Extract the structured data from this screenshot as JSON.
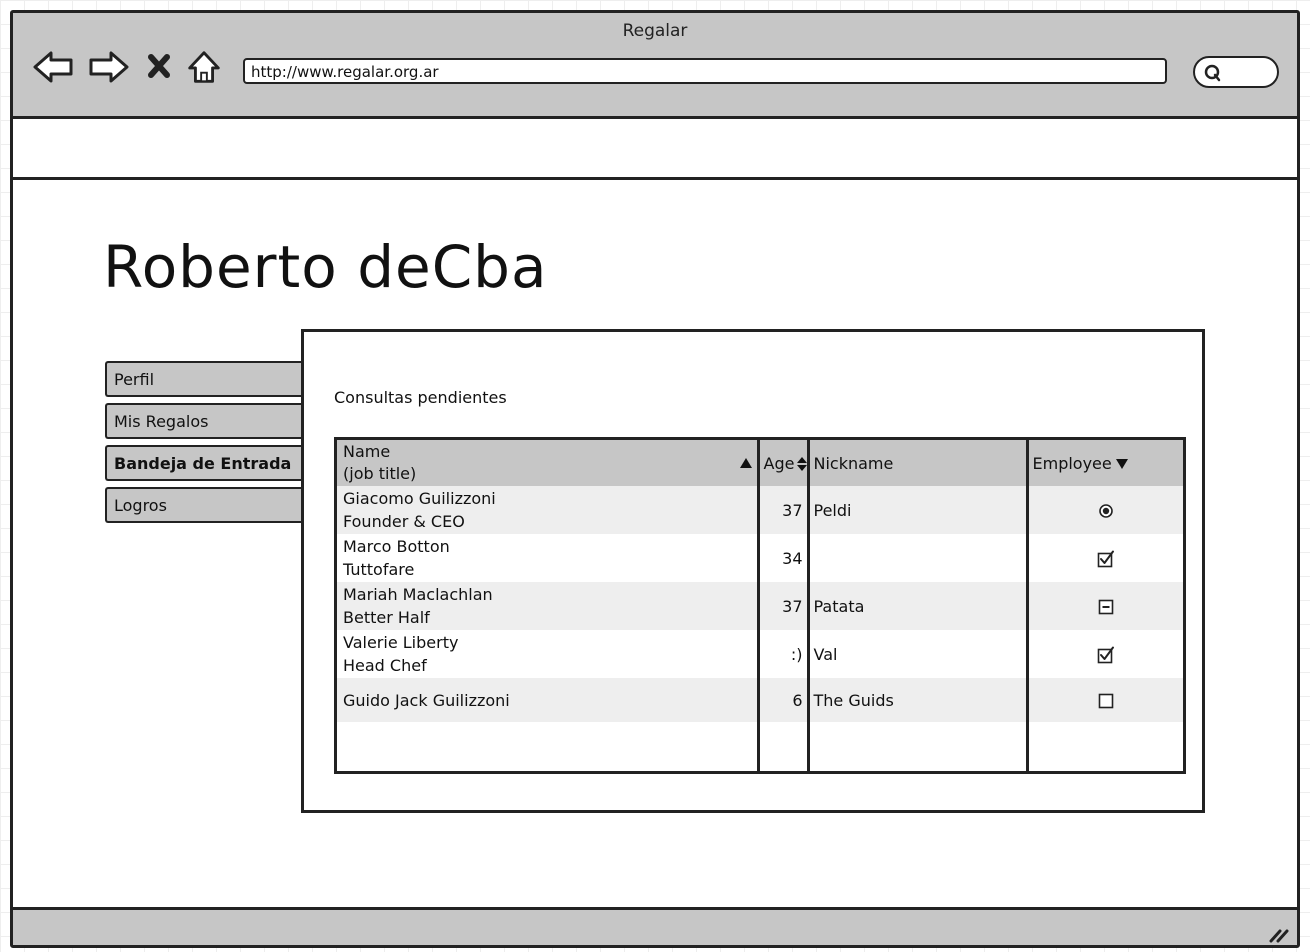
{
  "browser": {
    "title": "Regalar",
    "url": "http://www.regalar.org.ar",
    "nav_icons": [
      "back-arrow-icon",
      "forward-arrow-icon",
      "close-x-icon",
      "home-icon"
    ],
    "search_icon": "search-icon"
  },
  "page": {
    "title": "Roberto deCba"
  },
  "tabs": [
    {
      "label": "Perfil",
      "active": false
    },
    {
      "label": "Mis Regalos",
      "active": false
    },
    {
      "label": "Bandeja de Entrada",
      "active": true
    },
    {
      "label": "Logros",
      "active": false
    }
  ],
  "panel": {
    "label": "Consultas pendientes"
  },
  "table": {
    "headers": {
      "name_line1": "Name",
      "name_line2": "(job title)",
      "age": "Age",
      "nickname": "Nickname",
      "employee": "Employee"
    },
    "rows": [
      {
        "name": "Giacomo Guilizzoni",
        "title": "Founder & CEO",
        "age": "37",
        "nickname": "Peldi",
        "employee": "radio-selected"
      },
      {
        "name": "Marco Botton",
        "title": "Tuttofare",
        "age": "34",
        "nickname": "",
        "employee": "checkbox-checked"
      },
      {
        "name": "Mariah Maclachlan",
        "title": "Better Half",
        "age": "37",
        "nickname": "Patata",
        "employee": "checkbox-indeterminate"
      },
      {
        "name": "Valerie Liberty",
        "title": "Head Chef",
        "age": ":)",
        "nickname": "Val",
        "employee": "checkbox-checked"
      },
      {
        "name": "Guido Jack Guilizzoni",
        "title": "",
        "age": "6",
        "nickname": "The Guids",
        "employee": "checkbox-unchecked"
      }
    ]
  },
  "colors": {
    "chrome": "#c6c6c6",
    "stripe": "#eeeeee",
    "border": "#222222"
  }
}
